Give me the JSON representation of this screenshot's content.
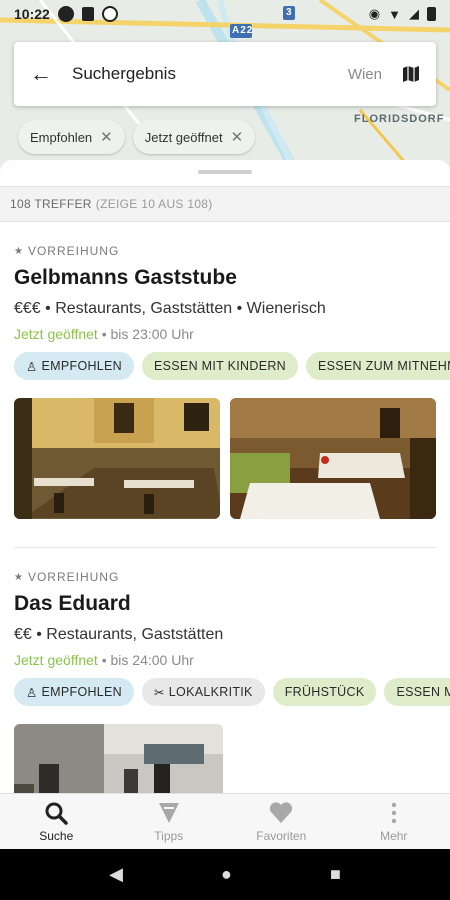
{
  "status_bar": {
    "time": "10:22"
  },
  "map": {
    "labels": [
      "A22",
      "3",
      "FLORIDSDORF"
    ]
  },
  "search": {
    "query": "Suchergebnis",
    "location": "Wien"
  },
  "filters": [
    {
      "label": "Empfohlen"
    },
    {
      "label": "Jetzt geöffnet"
    }
  ],
  "results": {
    "count_main": "108 TREFFER",
    "count_sub": "(ZEIGE 10 AUS 108)"
  },
  "entries": [
    {
      "kicker": "VORREIHUNG",
      "title": "Gelbmanns Gaststube",
      "meta": "€€€ • Restaurants, Gaststätten • Wienerisch",
      "open_status": "Jetzt geöffnet",
      "hours": " • bis 23:00 Uhr",
      "tags": [
        {
          "label": "EMPFOHLEN",
          "style": "blue",
          "icon": "person-icon"
        },
        {
          "label": "ESSEN MIT KINDERN",
          "style": "green"
        },
        {
          "label": "ESSEN ZUM MITNEHMEN",
          "style": "green"
        }
      ]
    },
    {
      "kicker": "VORREIHUNG",
      "title": "Das Eduard",
      "meta": "€€ • Restaurants, Gaststätten",
      "open_status": "Jetzt geöffnet",
      "hours": " • bis 24:00 Uhr",
      "tags": [
        {
          "label": "EMPFOHLEN",
          "style": "blue",
          "icon": "person-icon"
        },
        {
          "label": "LOKALKRITIK",
          "style": "grey",
          "icon": "cutlery-icon"
        },
        {
          "label": "FRÜHSTÜCK",
          "style": "green"
        },
        {
          "label": "ESSEN MIT K",
          "style": "green"
        }
      ]
    }
  ],
  "nav": [
    {
      "label": "Suche",
      "icon": "search-icon",
      "active": true
    },
    {
      "label": "Tipps",
      "icon": "tips-icon",
      "active": false
    },
    {
      "label": "Favoriten",
      "icon": "heart-icon",
      "active": false
    },
    {
      "label": "Mehr",
      "icon": "more-icon",
      "active": false
    }
  ],
  "colors": {
    "accent_green": "#8bc34a",
    "tag_blue": "#d4e9f2",
    "tag_green": "#dfecc9"
  }
}
